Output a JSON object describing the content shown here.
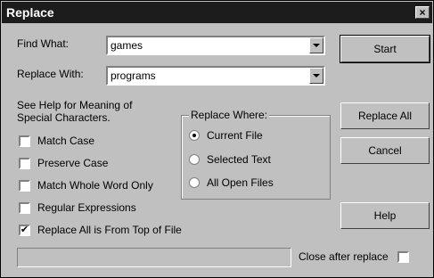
{
  "window": {
    "title": "Replace",
    "close_glyph": "×"
  },
  "find": {
    "label": "Find What:",
    "value": "games"
  },
  "replace": {
    "label": "Replace With:",
    "value": "programs"
  },
  "help_text": {
    "line1": "See Help for Meaning of",
    "line2": "Special Characters."
  },
  "options": {
    "match_case": {
      "label": "Match Case",
      "checked": false
    },
    "preserve_case": {
      "label": "Preserve Case",
      "checked": false
    },
    "whole_word": {
      "label": "Match Whole Word Only",
      "checked": false
    },
    "regex": {
      "label": "Regular Expressions",
      "checked": false
    },
    "from_top": {
      "label": "Replace All is From Top of File",
      "checked": true,
      "mark": "✔"
    }
  },
  "replace_where": {
    "title": "Replace Where:",
    "current_file": "Current File",
    "selected_text": "Selected Text",
    "all_open_files": "All Open Files",
    "selected": "current_file"
  },
  "buttons": {
    "start": "Start",
    "replace_all": "Replace All",
    "cancel": "Cancel",
    "help": "Help"
  },
  "close_after": {
    "label": "Close after replace",
    "checked": false
  },
  "status": {
    "text": ""
  }
}
